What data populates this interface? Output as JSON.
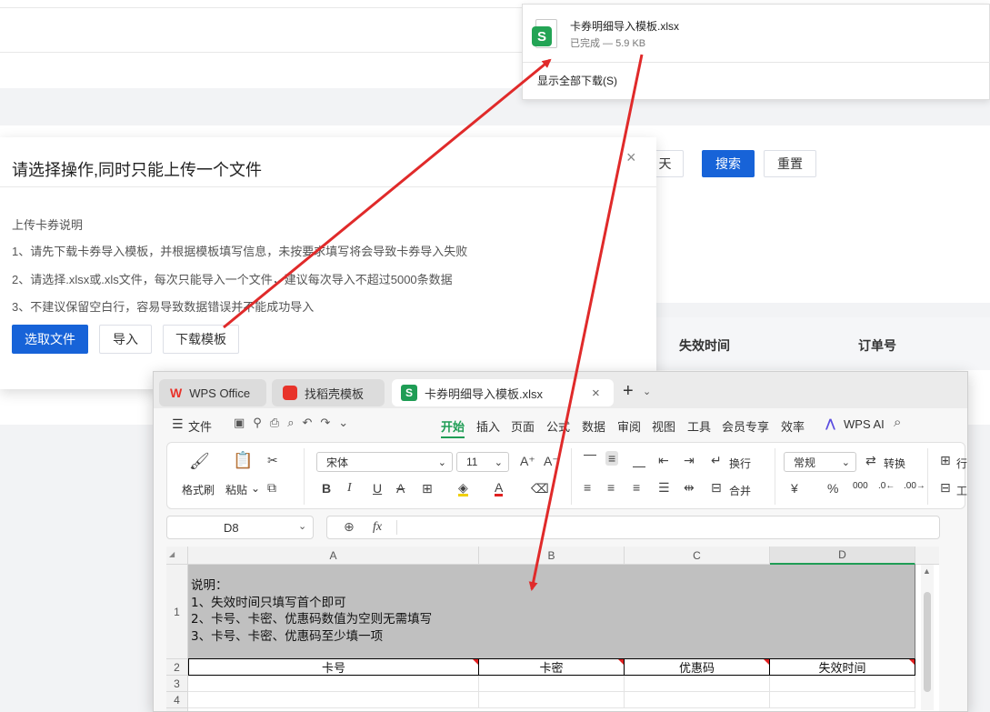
{
  "download": {
    "filename": "卡券明细导入模板.xlsx",
    "status": "已完成 — 5.9 KB",
    "show_all": "显示全部下载(S)",
    "icon_letter": "S"
  },
  "search_bar": {
    "date_fragment": "天",
    "search_label": "搜索",
    "reset_label": "重置"
  },
  "table_headers": {
    "expire": "失效时间",
    "order": "订单号"
  },
  "modal": {
    "title": "请选择操作,同时只能上传一个文件",
    "close": "×",
    "section": "上传卡券说明",
    "lines": [
      "1、请先下载卡券导入模板，并根据模板填写信息，未按要求填写将会导致卡券导入失败",
      "2、请选择.xlsx或.xls文件，每次只能导入一个文件，建议每次导入不超过5000条数据",
      "3、不建议保留空白行，容易导致数据错误并不能成功导入"
    ],
    "btn_choose": "选取文件",
    "btn_import": "导入",
    "btn_download": "下载模板"
  },
  "wps": {
    "tabs": [
      "WPS Office",
      "找稻壳模板",
      "卡券明细导入模板.xlsx"
    ],
    "tab_close": "×",
    "new_tab": "+",
    "file_menu": "文件",
    "menu": [
      "开始",
      "插入",
      "页面",
      "公式",
      "数据",
      "审阅",
      "视图",
      "工具",
      "会员专享",
      "效率"
    ],
    "wps_ai": "WPS AI",
    "ribbon": {
      "format_painter": "格式刷",
      "paste": "粘贴",
      "font": "宋体",
      "size": "11",
      "wrap": "换行",
      "merge": "合并",
      "number_format": "常规",
      "convert": "转换",
      "row_fragment": "行",
      "work_fragment": "工",
      "percent": "%",
      "currency": "¥"
    },
    "name_box": "D8",
    "fx": "fx",
    "columns": [
      "A",
      "B",
      "C",
      "D"
    ],
    "rows": [
      "1",
      "2",
      "3",
      "4"
    ],
    "note": "说明：\n1、失效时间只填写首个即可\n2、卡号、卡密、优惠码数值为空则无需填写\n3、卡号、卡密、优惠码至少填一项",
    "headers": [
      "卡号",
      "卡密",
      "优惠码",
      "失效时间"
    ],
    "side_number": "1"
  },
  "colors": {
    "primary": "#1763d8",
    "wps_green": "#1f9d55",
    "arrow": "#e02a2a",
    "wps_red": "#e8332a"
  }
}
